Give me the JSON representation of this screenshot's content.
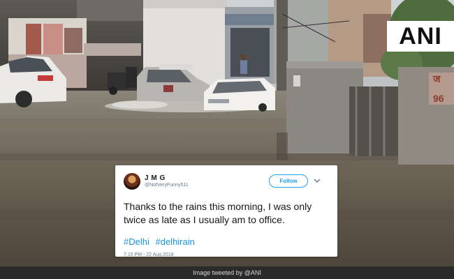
{
  "watermark": {
    "logo_text": "ANI"
  },
  "tweet": {
    "display_name": "J M G",
    "handle": "@NotVeryFunny511",
    "follow_label": "Follow",
    "text": "Thanks to the rains this morning, I was only twice as late as I usually am to office.",
    "hashtags": [
      "#Delhi",
      "#delhirain"
    ],
    "timestamp": "7:15 PM - 22 Aug 2018",
    "icons": {
      "menu": "chevron-down-icon",
      "avatar": "avatar"
    }
  },
  "caption": {
    "text": "Image tweeted by @ANI"
  },
  "colors": {
    "twitter_blue": "#1da1f2",
    "hashtag": "#1b95e0",
    "caption_bg": "#2a2a2a"
  }
}
